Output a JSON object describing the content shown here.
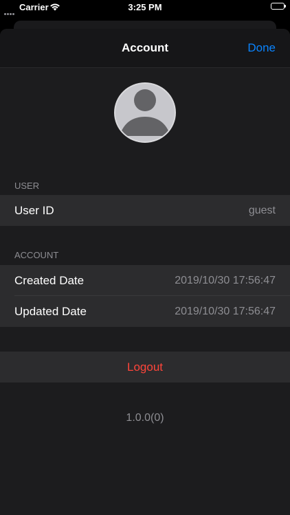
{
  "status_bar": {
    "carrier": "Carrier",
    "time": "3:25 PM",
    "battery_level": 1.0
  },
  "nav": {
    "title": "Account",
    "done_label": "Done"
  },
  "sections": {
    "user": {
      "header": "USER",
      "rows": [
        {
          "label": "User ID",
          "value": "guest"
        }
      ]
    },
    "account": {
      "header": "ACCOUNT",
      "rows": [
        {
          "label": "Created Date",
          "value": "2019/10/30 17:56:47"
        },
        {
          "label": "Updated Date",
          "value": "2019/10/30 17:56:47"
        }
      ]
    }
  },
  "logout_label": "Logout",
  "version": "1.0.0(0)",
  "colors": {
    "accent": "#0a84ff",
    "destructive": "#ff453a",
    "secondary_text": "#8e8e93"
  },
  "icons": {
    "signal": "cellular-signal-icon",
    "wifi": "wifi-icon",
    "battery": "battery-icon",
    "avatar": "person-placeholder-icon"
  }
}
